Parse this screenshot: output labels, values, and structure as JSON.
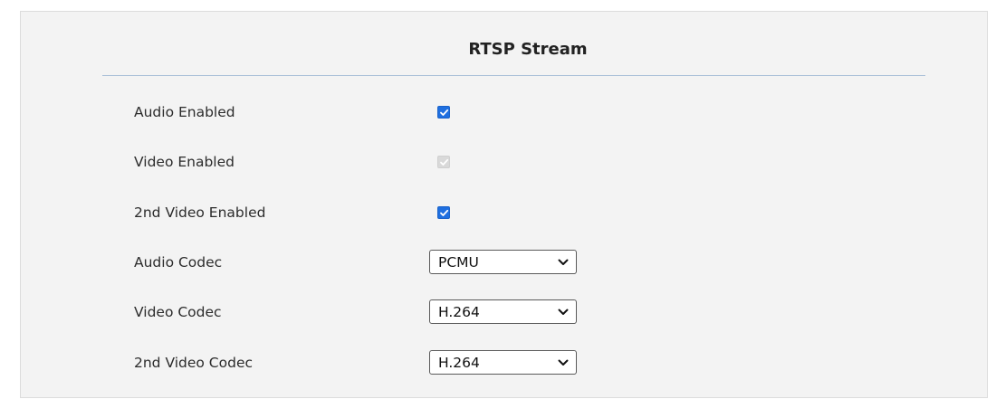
{
  "section": {
    "title": "RTSP Stream"
  },
  "fields": {
    "audio_enabled": {
      "label": "Audio Enabled",
      "checked": true,
      "disabled": false
    },
    "video_enabled": {
      "label": "Video Enabled",
      "checked": true,
      "disabled": true
    },
    "second_video_enabled": {
      "label": "2nd Video Enabled",
      "checked": true,
      "disabled": false
    },
    "audio_codec": {
      "label": "Audio Codec",
      "value": "PCMU",
      "icon": "chevron-down-icon"
    },
    "video_codec": {
      "label": "Video Codec",
      "value": "H.264",
      "icon": "chevron-down-icon"
    },
    "second_video_codec": {
      "label": "2nd Video Codec",
      "value": "H.264",
      "icon": "chevron-down-icon"
    }
  },
  "colors": {
    "checkbox_on": "#1f6fe0",
    "checkbox_disabled": "#d9d9d9",
    "panel_bg": "#f3f3f3",
    "divider": "#a9bfd8"
  }
}
